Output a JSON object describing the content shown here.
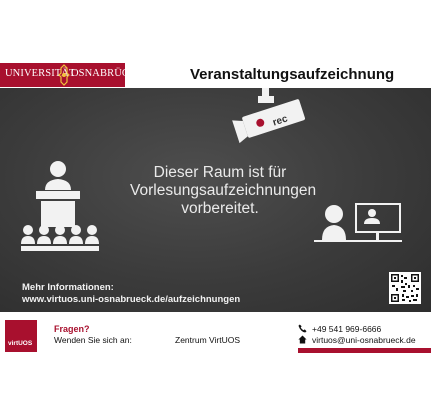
{
  "header": {
    "logo_left": "UNIVERSITÄT",
    "logo_right": "OSNABRÜCK",
    "title": "Veranstaltungsaufzeichnung"
  },
  "board": {
    "message_lines": [
      "Dieser Raum ist für",
      "Vorlesungsaufzeichnungen",
      "vorbereitet."
    ],
    "camera_label": "rec",
    "info_label": "Mehr Informationen:",
    "info_url": "www.virtuos.uni-osnabrueck.de/aufzeichnungen"
  },
  "footer": {
    "logo_text": "virtUOS",
    "question": "Fragen?",
    "contact_prompt": "Wenden Sie sich an:",
    "department": "Zentrum VirtUOS",
    "phone": "+49 541 969-6666",
    "email": "virtuos@uni-osnabrueck.de"
  },
  "colors": {
    "brand_red": "#a8102e",
    "board_dark": "#3b3b3b",
    "chalk": "#f2f2f2"
  },
  "icons": [
    "university-seal-icon",
    "camera-icon",
    "lectern-audience-icon",
    "viewer-at-monitor-icon",
    "qr-code-icon",
    "phone-icon",
    "house-icon"
  ]
}
